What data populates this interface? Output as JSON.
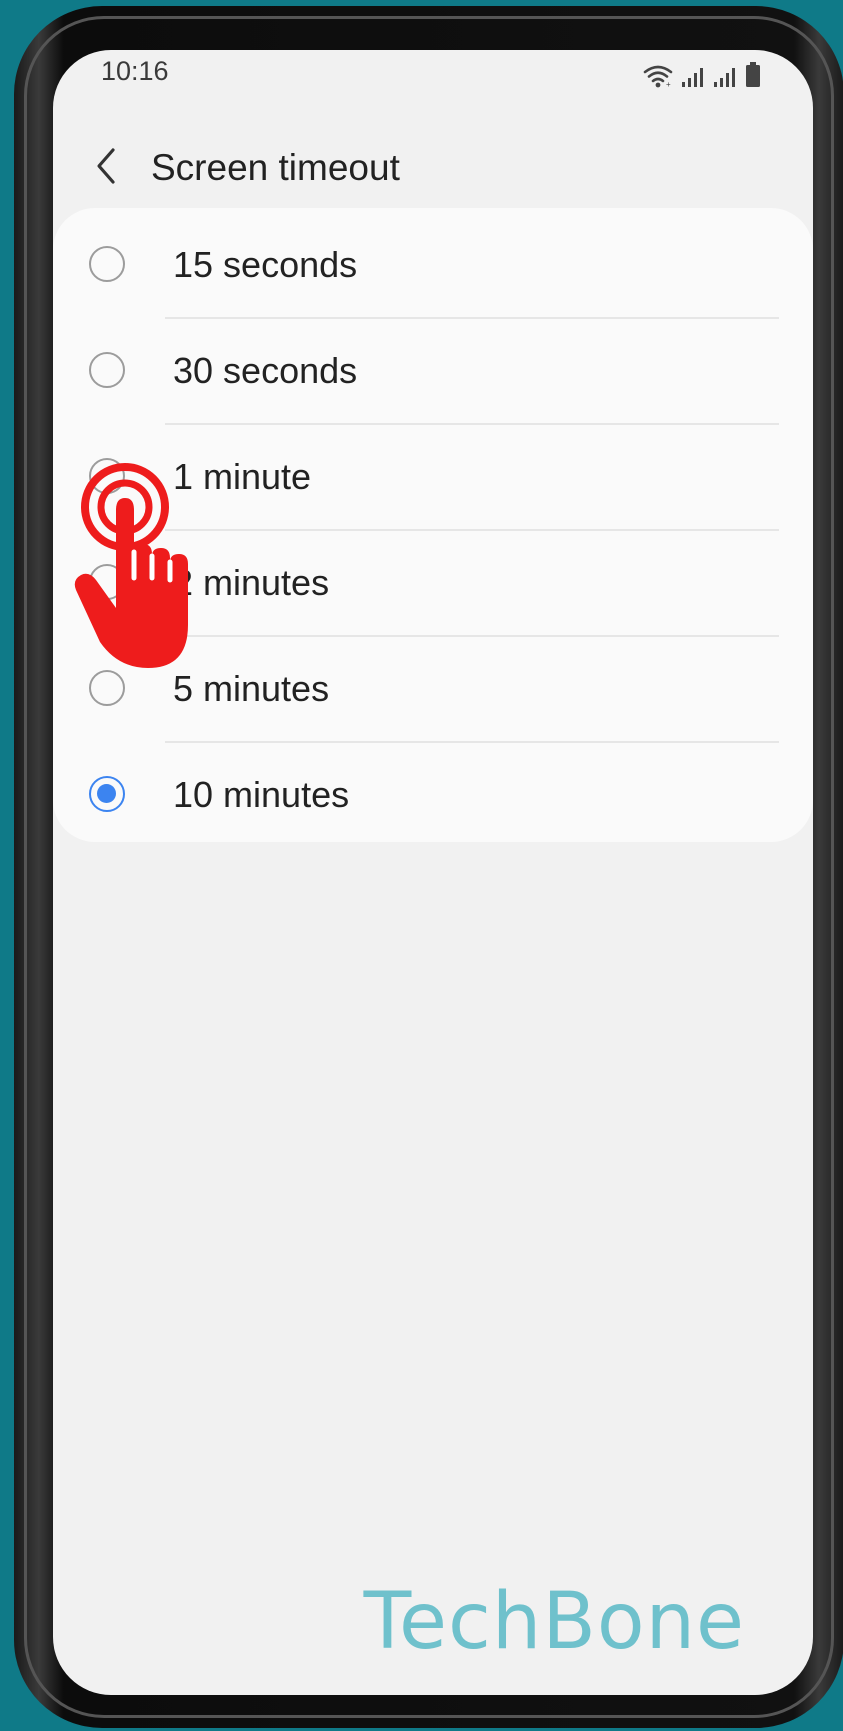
{
  "status_bar": {
    "time": "10:16",
    "icons": [
      "wifi-icon",
      "signal-icon",
      "signal-icon",
      "battery-icon"
    ]
  },
  "header": {
    "back_icon": "chevron-left-icon",
    "title": "Screen timeout"
  },
  "options": [
    {
      "label": "15 seconds",
      "selected": false
    },
    {
      "label": "30 seconds",
      "selected": false
    },
    {
      "label": "1 minute",
      "selected": false
    },
    {
      "label": "2 minutes",
      "selected": false
    },
    {
      "label": "5 minutes",
      "selected": false
    },
    {
      "label": "10 minutes",
      "selected": true
    }
  ],
  "overlay": {
    "icon": "tap-hand-icon",
    "color": "#ee1c1c"
  },
  "colors": {
    "accent": "#3c84f0",
    "background": "#f1f1f1",
    "card": "#fafafa",
    "frame_backdrop": "#0f7a88",
    "watermark": "#6fc1cc"
  },
  "watermark": "TechBone"
}
